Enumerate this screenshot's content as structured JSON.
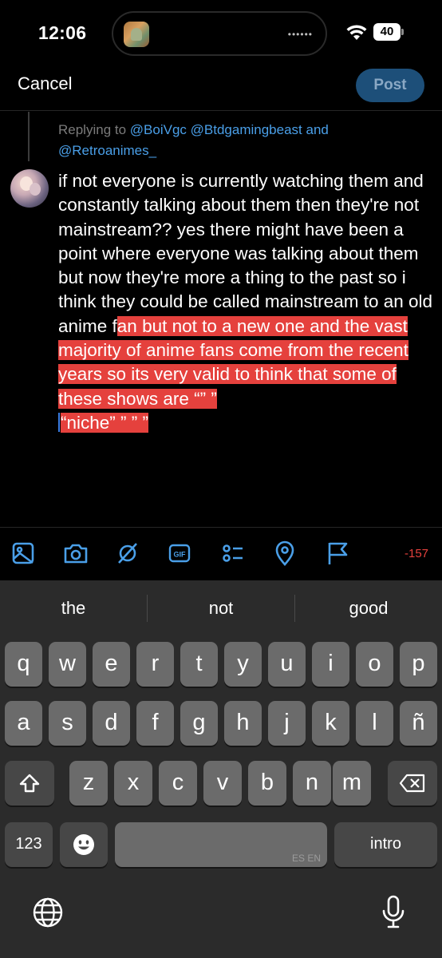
{
  "status_bar": {
    "time": "12:06",
    "battery": "40"
  },
  "header": {
    "cancel": "Cancel",
    "post": "Post"
  },
  "reply_context": {
    "prefix": "Replying to",
    "mentions": [
      "@BoiVgc",
      "@Btdgamingbeast",
      "@Retroanimes_"
    ],
    "conjunction": "and"
  },
  "composer": {
    "text_before_selection": "if not everyone is currently watching them and constantly talking about them then they're not mainstream?? yes there might have been a point where everyone was talking about them but now they're more a thing to the past so i think they could be called mainstream to an old anime f",
    "text_selected": "an but not to a new one and the vast majority of anime fans come from the recent years so its very valid to think that some of these shows are “” ”",
    "text_selected_tail": "“niche” ” ” ”"
  },
  "toolbar": {
    "icons": [
      "image-icon",
      "camera-icon",
      "gif-icon-label",
      "list-icon",
      "location-icon",
      "flag-icon"
    ],
    "gif_label": "GIF",
    "char_count": "-157"
  },
  "keyboard": {
    "suggestions": [
      "the",
      "not",
      "good"
    ],
    "row1": [
      "q",
      "w",
      "e",
      "r",
      "t",
      "y",
      "u",
      "i",
      "o",
      "p"
    ],
    "row2": [
      "a",
      "s",
      "d",
      "f",
      "g",
      "h",
      "j",
      "k",
      "l",
      "ñ"
    ],
    "row3": [
      "z",
      "x",
      "c",
      "v",
      "b",
      "n",
      "m"
    ],
    "numbers_key": "123",
    "space_lang": "ES EN",
    "return_key": "intro"
  },
  "colors": {
    "accent": "#4a9fe8",
    "selection": "#e5413d",
    "post_button": "#1d4f79"
  }
}
